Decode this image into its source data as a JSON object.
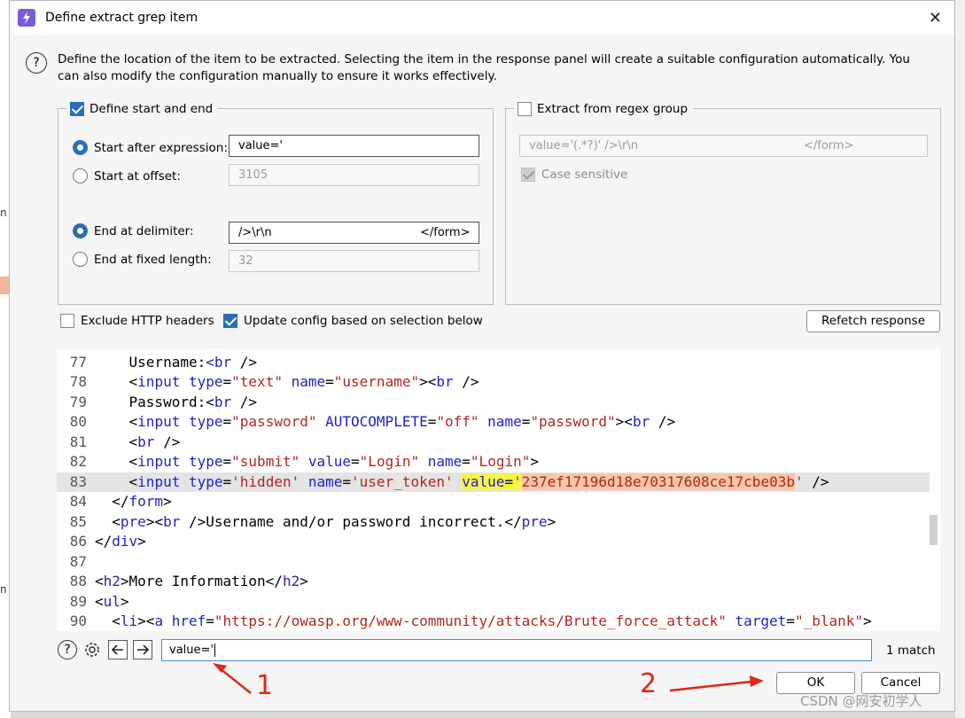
{
  "background": {
    "left_marks": [
      "n",
      "n"
    ]
  },
  "dialog": {
    "title": "Define extract grep item",
    "close_glyph": "✕",
    "help_glyph": "?",
    "description": "Define the location of the item to be extracted. Selecting the item in the response panel will create a suitable configuration automatically. You can also modify the configuration manually to ensure it works effectively.",
    "start_end": {
      "label": "Define start and end",
      "checked": true,
      "start_after_label": "Start after expression:",
      "start_after_value": "value='",
      "start_offset_label": "Start at offset:",
      "start_offset_value": "3105",
      "end_delimiter_label": "End at delimiter:",
      "end_delimiter_value": "/>\\r\\n",
      "end_delimiter_value_right": "</form>",
      "end_fixed_label": "End at fixed length:",
      "end_fixed_value": "32"
    },
    "regex": {
      "label": "Extract from regex group",
      "checked": false,
      "expression": "value='(.*?)' />\\r\\n",
      "expression_right": "</form>",
      "case_sensitive_label": "Case sensitive",
      "case_sensitive_checked": true
    },
    "exclude_headers_label": "Exclude HTTP headers",
    "update_config_label": "Update config based on selection below",
    "refetch_label": "Refetch response",
    "code_lines": [
      {
        "n": "77"
      },
      {
        "n": "78"
      },
      {
        "n": "79"
      },
      {
        "n": "80"
      },
      {
        "n": "81"
      },
      {
        "n": "82"
      },
      {
        "n": "83"
      },
      {
        "n": "84"
      },
      {
        "n": "85"
      },
      {
        "n": "86"
      },
      {
        "n": "87"
      },
      {
        "n": "88"
      },
      {
        "n": "89"
      },
      {
        "n": "90"
      }
    ],
    "search_value": "value='",
    "match_count": "1 match",
    "ok_label": "OK",
    "cancel_label": "Cancel"
  },
  "annotations": {
    "one": "1",
    "two": "2"
  },
  "watermark": "CSDN @网安初学人",
  "colors": {
    "accent": "#2a6fb6",
    "highlight_yellow": "#f5f548",
    "highlight_orange": "#f6c7a8",
    "annotation_red": "#e1251b"
  }
}
